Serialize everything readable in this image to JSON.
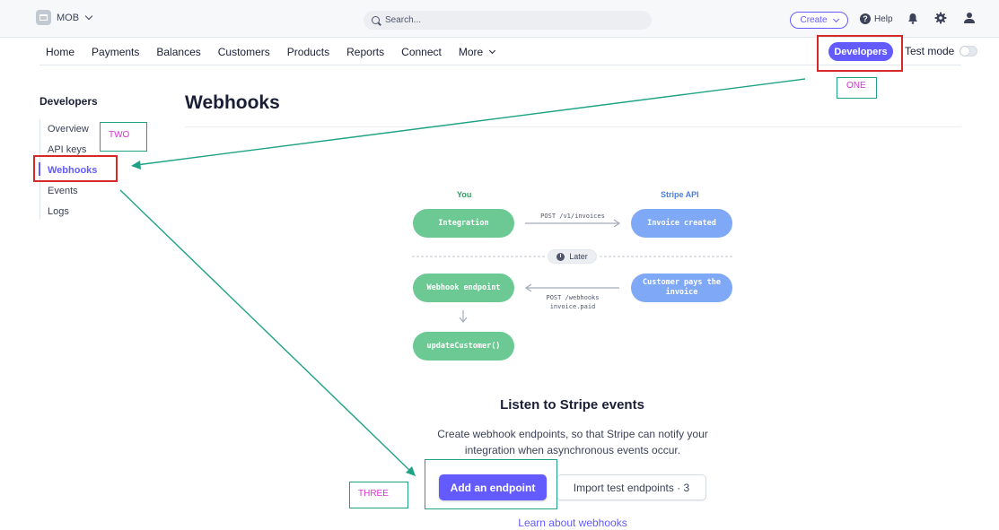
{
  "topbar": {
    "account_name": "MOB",
    "search_placeholder": "Search...",
    "create_label": "Create",
    "help_label": "Help"
  },
  "nav": {
    "items": [
      "Home",
      "Payments",
      "Balances",
      "Customers",
      "Products",
      "Reports",
      "Connect"
    ],
    "more_label": "More",
    "developers_label": "Developers",
    "test_mode_label": "Test mode",
    "test_mode_on": false
  },
  "sidebar": {
    "title": "Developers",
    "items": [
      "Overview",
      "API keys",
      "Webhooks",
      "Events",
      "Logs"
    ],
    "active": "Webhooks"
  },
  "main": {
    "title": "Webhooks",
    "diagram": {
      "you_label": "You",
      "stripe_label": "Stripe API",
      "integration": "Integration",
      "post_invoices": "POST /v1/invoices",
      "invoice_created": "Invoice created",
      "later": "Later",
      "webhook_endpoint": "Webhook endpoint",
      "post_webhooks_line1": "POST /webhooks",
      "post_webhooks_line2": "invoice.paid",
      "customer_pays": "Customer pays the invoice",
      "update_customer": "updateCustomer()"
    },
    "listen_title": "Listen to Stripe events",
    "listen_desc": "Create webhook endpoints, so that Stripe can notify your integration when asynchronous events occur.",
    "add_endpoint_label": "Add an endpoint",
    "import_label": "Import test endpoints · 3",
    "learn_link": "Learn about webhooks"
  },
  "annotations": {
    "one": "ONE",
    "two": "TWO",
    "three": "THREE"
  },
  "colors": {
    "accent": "#635bff",
    "green": "#6cc993",
    "blue": "#7fa9f7",
    "annotation_red": "#d62828",
    "annotation_teal": "#1fa384",
    "annotation_text": "#d633d6"
  }
}
